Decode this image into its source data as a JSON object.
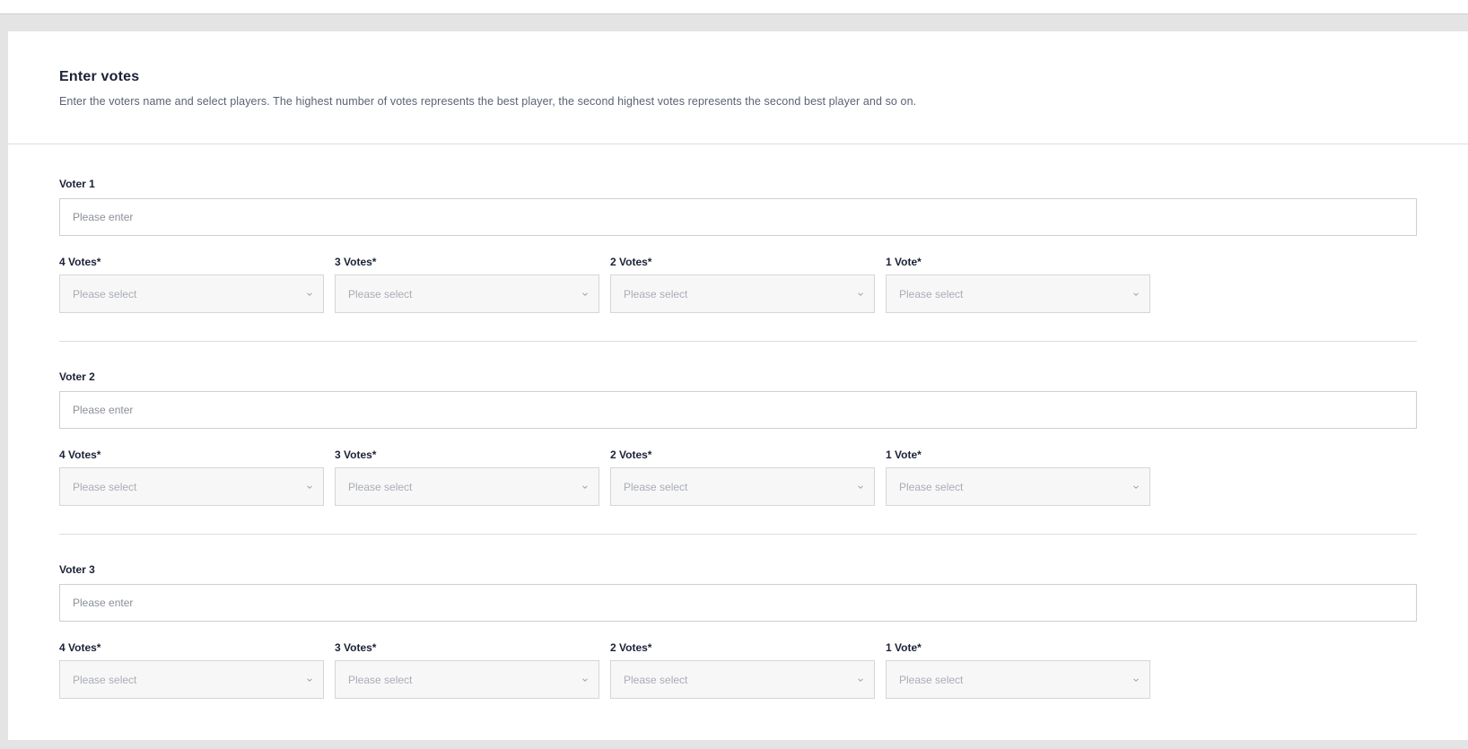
{
  "header": {
    "title": "Enter votes",
    "description": "Enter the voters name and select players. The highest number of votes represents the best player, the second highest votes represents the second best player and so on."
  },
  "vote_labels": [
    "4 Votes*",
    "3 Votes*",
    "2 Votes*",
    "1 Vote*"
  ],
  "voters": [
    {
      "label": "Voter 1",
      "name_value": "",
      "name_placeholder": "Please enter",
      "selects": [
        "Please select",
        "Please select",
        "Please select",
        "Please select"
      ]
    },
    {
      "label": "Voter 2",
      "name_value": "",
      "name_placeholder": "Please enter",
      "selects": [
        "Please select",
        "Please select",
        "Please select",
        "Please select"
      ]
    },
    {
      "label": "Voter 3",
      "name_value": "",
      "name_placeholder": "Please enter",
      "selects": [
        "Please select",
        "Please select",
        "Please select",
        "Please select"
      ]
    }
  ],
  "icons": {
    "select_arrow": "chevron-down-icon"
  },
  "colors": {
    "text_primary": "#1b2236",
    "text_secondary": "#5b6275",
    "placeholder": "#a9adb5",
    "select_background": "#f7f7f7",
    "page_background": "#e4e4e4"
  }
}
